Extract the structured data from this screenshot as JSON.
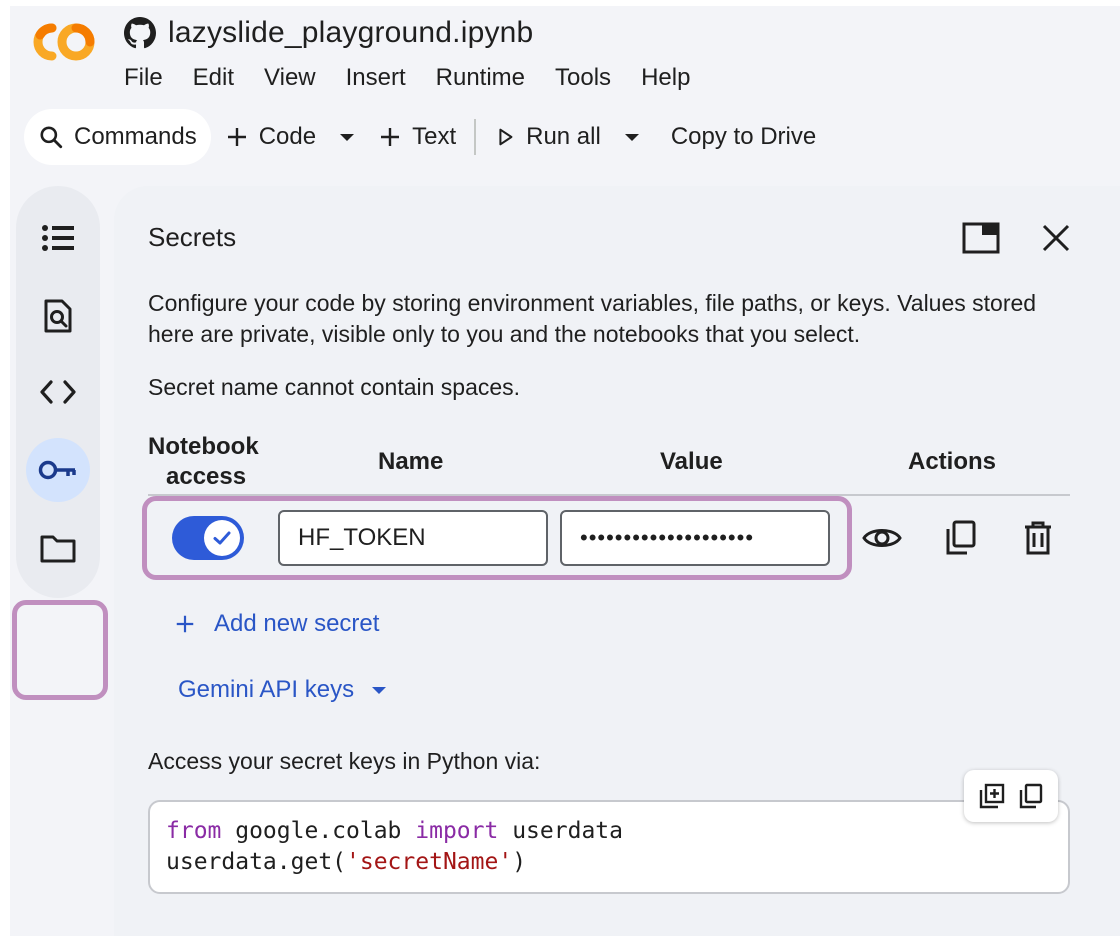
{
  "header": {
    "title": "lazyslide_playground.ipynb",
    "menu": [
      "File",
      "Edit",
      "View",
      "Insert",
      "Runtime",
      "Tools",
      "Help"
    ]
  },
  "toolbar": {
    "commands_label": "Commands",
    "code_label": "Code",
    "text_label": "Text",
    "run_all_label": "Run all",
    "copy_to_drive_label": "Copy to Drive"
  },
  "rail": {
    "items": [
      "toc-icon",
      "find-icon",
      "code-snippets-icon",
      "key-icon",
      "folder-icon"
    ],
    "active": "key-icon"
  },
  "panel": {
    "title": "Secrets",
    "description": "Configure your code by storing environment variables, file paths, or keys. Values stored here are private, visible only to you and the notebooks that you select.",
    "note": "Secret name cannot contain spaces.",
    "columns": {
      "access_line1": "Notebook",
      "access_line2": "access",
      "name": "Name",
      "value": "Value",
      "actions": "Actions"
    },
    "secret": {
      "notebook_access": true,
      "name": "HF_TOKEN",
      "value_masked": "••••••••••••••••••••"
    },
    "add_secret_label": "Add new secret",
    "gemini_label": "Gemini API keys",
    "access_label": "Access your secret keys in Python via:",
    "code": {
      "line1_kw1": "from",
      "line1_mod": " google.colab ",
      "line1_kw2": "import",
      "line1_name": " userdata",
      "line2_call": "userdata.get(",
      "line2_str": "'secretName'",
      "line2_end": ")"
    }
  },
  "colors": {
    "accent": "#2a56c6",
    "toggle": "#2e5bd8",
    "highlight": "#c08fbf",
    "keyword": "#8a2ba5",
    "string": "#a31515"
  }
}
